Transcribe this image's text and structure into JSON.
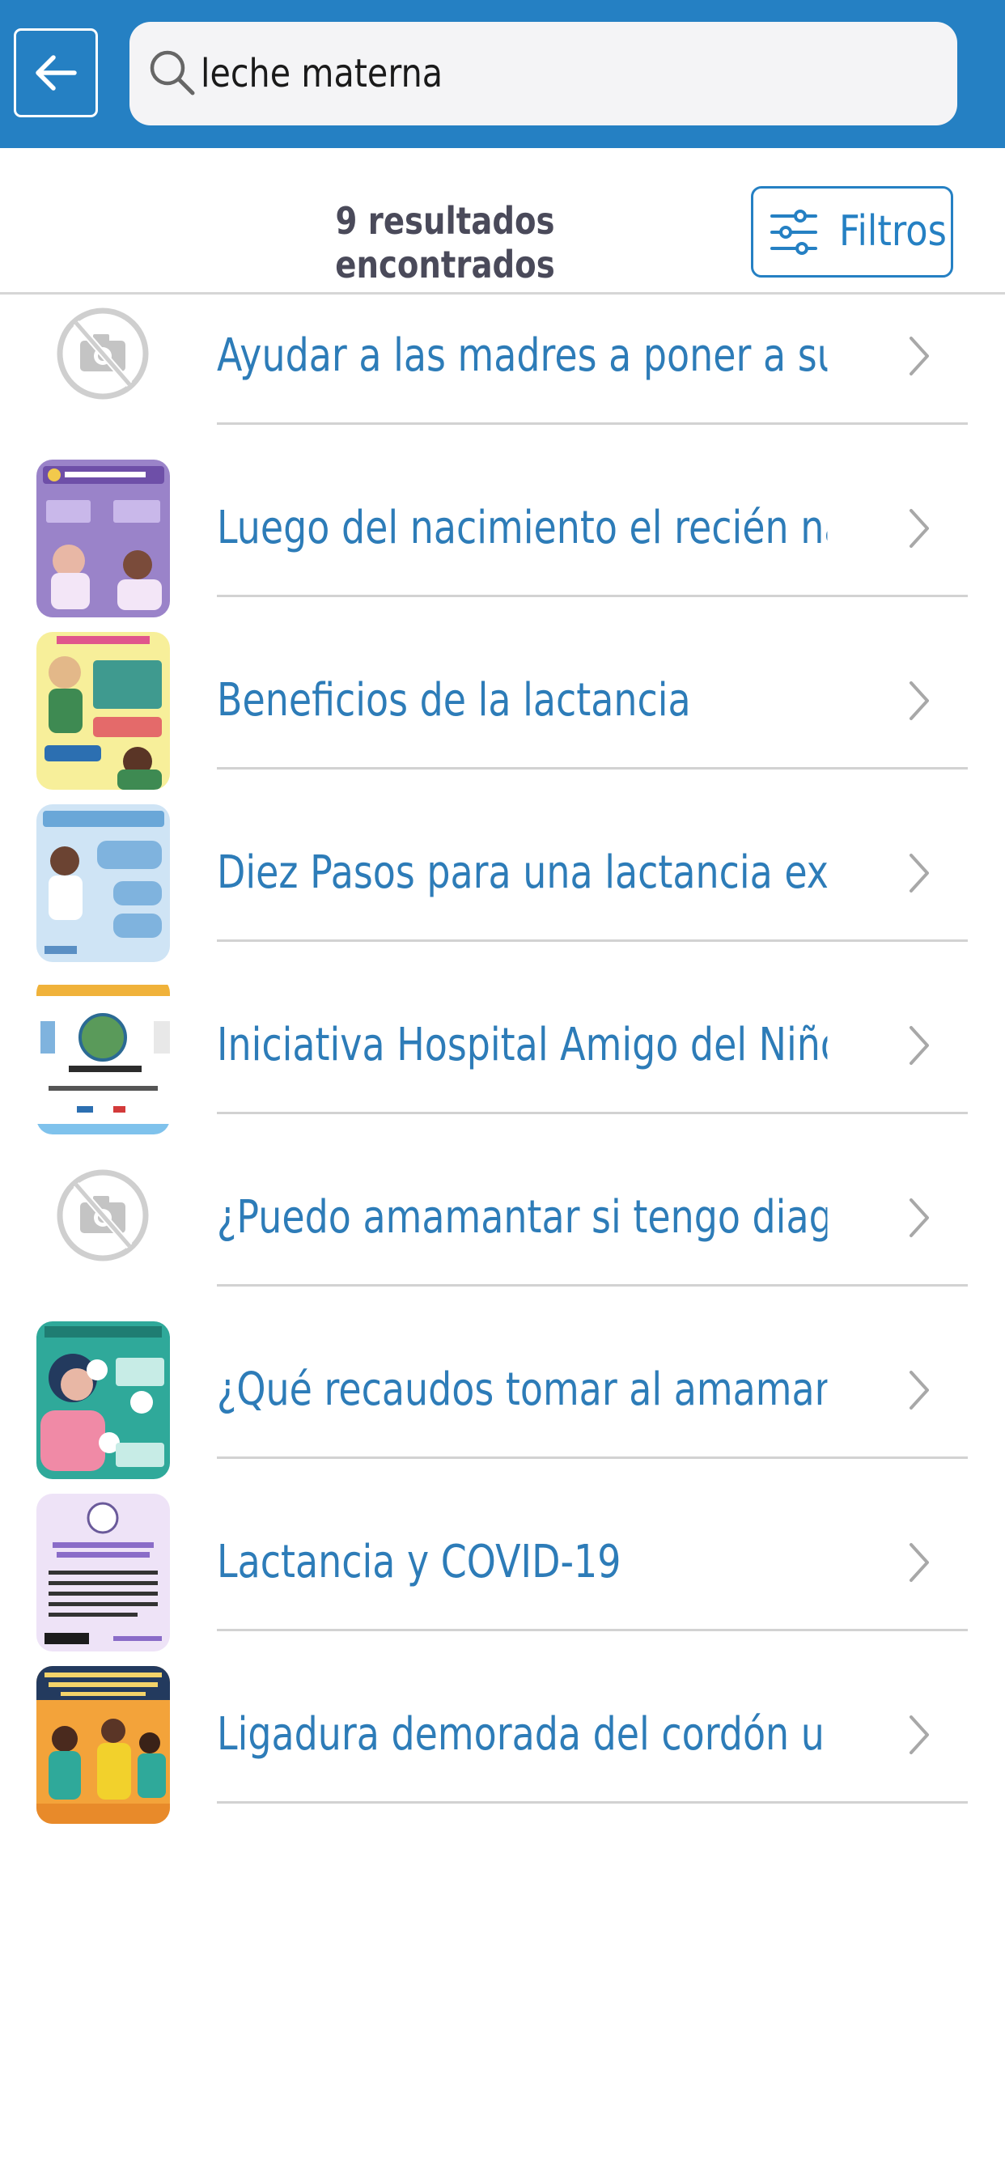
{
  "search": {
    "query": "leche materna"
  },
  "results_header": {
    "count_label": "9 resultados encontrados",
    "filter_label": "Filtros"
  },
  "colors": {
    "primary": "#2580c3",
    "title_text": "#2d7cb8",
    "divider": "#d2d2d2"
  },
  "results": [
    {
      "title": "Ayudar a las madres a poner a su beb…",
      "thumbnail": "no-image-placeholder-icon"
    },
    {
      "title": "Luego del nacimiento el recién nacido…",
      "thumbnail": "purple-rooming-in-infographic"
    },
    {
      "title": "Beneficios de la lactancia",
      "thumbnail": "yellow-baby-infographic"
    },
    {
      "title": "Diez Pasos para una lactancia exitosa",
      "thumbnail": "light-blue-hospital-policy-infographic"
    },
    {
      "title": "Iniciativa Hospital Amigo del Niño",
      "thumbnail": "world-breastfeeding-week-poster"
    },
    {
      "title": "¿Puedo amamantar si tengo diagnósti…",
      "thumbnail": "no-image-placeholder-icon"
    },
    {
      "title": "¿Qué recaudos tomar al amamantar si…",
      "thumbnail": "teal-mother-covid-infographic"
    },
    {
      "title": "Lactancia y COVID-19",
      "thumbnail": "lavender-ops-covid-infographic"
    },
    {
      "title": "Ligadura demorada del cordón umbili…",
      "thumbnail": "orange-umbilical-cord-infographic"
    }
  ]
}
